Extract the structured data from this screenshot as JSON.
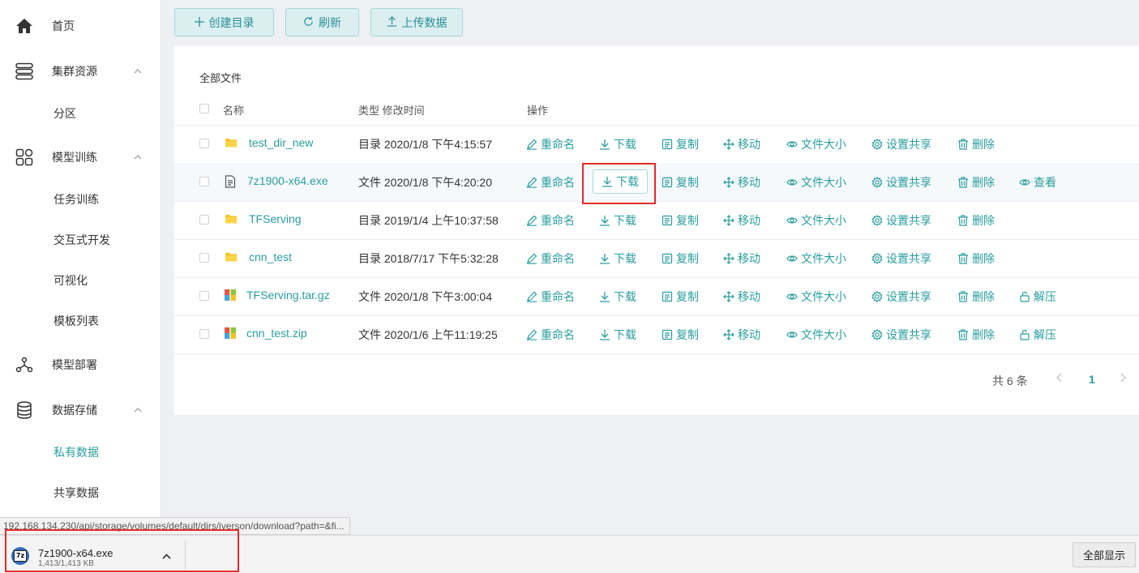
{
  "sidebar": {
    "items": [
      {
        "label": "首页"
      },
      {
        "label": "集群资源"
      },
      {
        "label": "分区"
      },
      {
        "label": "模型训练"
      },
      {
        "label": "任务训练"
      },
      {
        "label": "交互式开发"
      },
      {
        "label": "可视化"
      },
      {
        "label": "模板列表"
      },
      {
        "label": "模型部署"
      },
      {
        "label": "数据存储"
      },
      {
        "label": "私有数据"
      },
      {
        "label": "共享数据"
      }
    ]
  },
  "toolbar": {
    "create_dir": "创建目录",
    "refresh": "刷新",
    "upload": "上传数据"
  },
  "panel": {
    "title": "全部文件",
    "col_name": "名称",
    "col_type_time": "类型 修改时间",
    "col_actions": "操作"
  },
  "actions": {
    "rename": "重命名",
    "download": "下载",
    "copy": "复制",
    "move": "移动",
    "size": "文件大小",
    "share": "设置共享",
    "delete": "删除",
    "view": "查看",
    "extract": "解压"
  },
  "files": [
    {
      "name": "test_dir_new",
      "type_time": "目录 2020/1/8 下午4:15:57",
      "icon": "folder-icon"
    },
    {
      "name": "7z1900-x64.exe",
      "type_time": "文件 2020/1/8 下午4:20:20",
      "icon": "file-icon"
    },
    {
      "name": "TFServing",
      "type_time": "目录 2019/1/4 上午10:37:58",
      "icon": "folder-icon"
    },
    {
      "name": "cnn_test",
      "type_time": "目录 2018/7/17 下午5:32:28",
      "icon": "folder-icon"
    },
    {
      "name": "TFServing.tar.gz",
      "type_time": "文件 2020/1/8 下午3:00:04",
      "icon": "archive-icon"
    },
    {
      "name": "cnn_test.zip",
      "type_time": "文件 2020/1/6 上午11:19:25",
      "icon": "archive-icon"
    }
  ],
  "pagination": {
    "total": "共 6 条",
    "current": "1"
  },
  "status_url": "192.168.134.230/api/storage/volumes/default/dirs/iverson/download?path=&fi...",
  "download_bar": {
    "filename": "7z1900-x64.exe",
    "size": "1,413/1,413 KB",
    "show_all": "全部显示"
  },
  "colors": {
    "accent": "#2a9d9d",
    "highlight_red": "#e52a2a"
  }
}
